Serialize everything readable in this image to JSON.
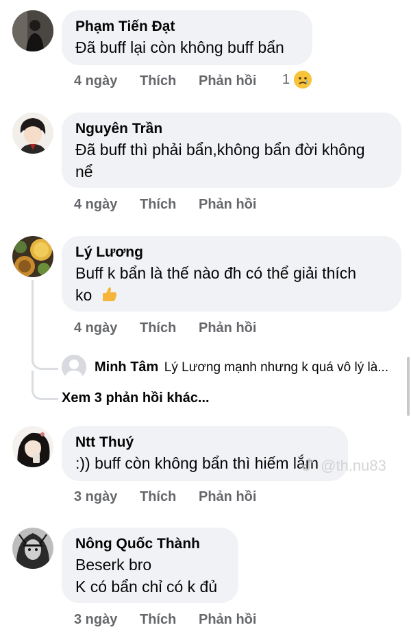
{
  "comments": [
    {
      "name": "Phạm Tiến Đạt",
      "lines": [
        "Đã buff lại còn không buff bẩn"
      ],
      "time": "4 ngày",
      "like": "Thích",
      "reply": "Phản hồi",
      "reaction_count": "1",
      "reaction_icon": "sad-face-icon"
    },
    {
      "name": "Nguyên Trần",
      "lines": [
        "Đã buff thì phải bẩn,không bẩn đời không",
        "nể"
      ],
      "time": "4 ngày",
      "like": "Thích",
      "reply": "Phản hồi"
    },
    {
      "name": "Lý Lương",
      "lines": [
        "Buff k bẩn là thế nào đh có thể giải thích",
        "ko"
      ],
      "time": "4 ngày",
      "like": "Thích",
      "reply": "Phản hồi",
      "inline_icon": "thumbs-up-icon",
      "reply_preview": {
        "name": "Minh Tâm",
        "text": "Lý Lương mạnh nhưng k quá vô lý là..."
      },
      "more_replies": "Xem 3 phản hồi khác..."
    },
    {
      "name": "Ntt Thuý",
      "lines": [
        ":)) buff còn không bẩn thì hiếm lắm"
      ],
      "time": "3 ngày",
      "like": "Thích",
      "reply": "Phản hồi"
    },
    {
      "name": "Nông Quốc Thành",
      "lines": [
        "Beserk bro",
        "K có bẩn chỉ có k đủ"
      ],
      "time": "3 ngày",
      "like": "Thích",
      "reply": "Phản hồi"
    }
  ],
  "watermark": "@th.nu83",
  "colors": {
    "bubble": "#f0f2f5",
    "meta": "#65676b",
    "text": "#050505",
    "thread": "#dadde1"
  }
}
